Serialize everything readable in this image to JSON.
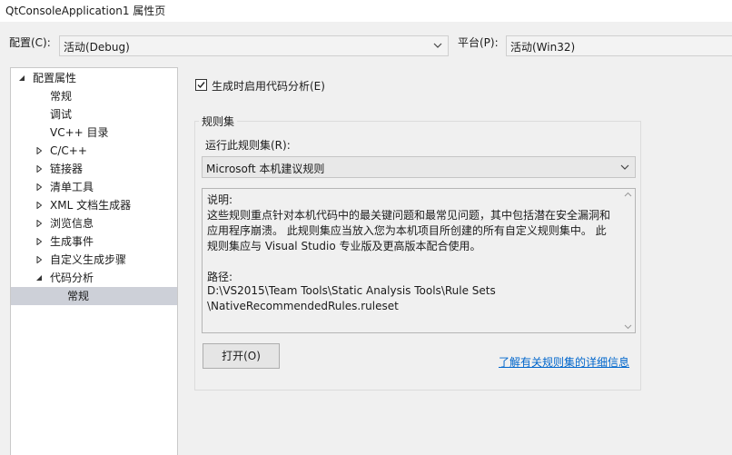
{
  "window": {
    "title": "QtConsoleApplication1 属性页"
  },
  "config_bar": {
    "configuration_label": "配置(C):",
    "configuration_value": "活动(Debug)",
    "platform_label": "平台(P):",
    "platform_value": "活动(Win32)"
  },
  "tree": {
    "nodes": [
      {
        "label": "配置属性",
        "expander": "expanded"
      },
      {
        "label": "常规",
        "expander": "none"
      },
      {
        "label": "调试",
        "expander": "none"
      },
      {
        "label": "VC++ 目录",
        "expander": "none"
      },
      {
        "label": "C/C++",
        "expander": "collapsed"
      },
      {
        "label": "链接器",
        "expander": "collapsed"
      },
      {
        "label": "清单工具",
        "expander": "collapsed"
      },
      {
        "label": "XML 文档生成器",
        "expander": "collapsed"
      },
      {
        "label": "浏览信息",
        "expander": "collapsed"
      },
      {
        "label": "生成事件",
        "expander": "collapsed"
      },
      {
        "label": "自定义生成步骤",
        "expander": "collapsed"
      },
      {
        "label": "代码分析",
        "expander": "expanded"
      },
      {
        "label": "常规",
        "expander": "none",
        "selected": true
      }
    ]
  },
  "main": {
    "enable_analysis_label": "生成时启用代码分析(E)",
    "enable_analysis_checked": true,
    "rule_set_group_title": "规则集",
    "run_rule_set_label": "运行此规则集(R):",
    "rule_set_value": "Microsoft 本机建议规则",
    "description": {
      "heading": "说明:",
      "line1": "这些规则重点针对本机代码中的最关键问题和最常见问题，其中包括潜在安全漏洞和",
      "line2": "应用程序崩溃。 此规则集应当放入您为本机项目所创建的所有自定义规则集中。 此",
      "line3": "规则集应与 Visual Studio 专业版及更高版本配合使用。",
      "path_heading": "路径:",
      "path1": "D:\\VS2015\\Team Tools\\Static Analysis Tools\\Rule Sets",
      "path2": "\\NativeRecommendedRules.ruleset"
    },
    "open_button": "打开(O)",
    "learn_more_link": "了解有关规则集的详细信息"
  },
  "icons": {
    "dropdown": "chevron-down-icon",
    "tree_expanded": "triangle-expanded-icon",
    "tree_collapsed": "triangle-collapsed-icon",
    "checkbox": "checkmark-icon"
  },
  "colors": {
    "selection": "#cdd0d8",
    "link": "#0066cc",
    "dialog_bg": "#f0f0f0"
  }
}
